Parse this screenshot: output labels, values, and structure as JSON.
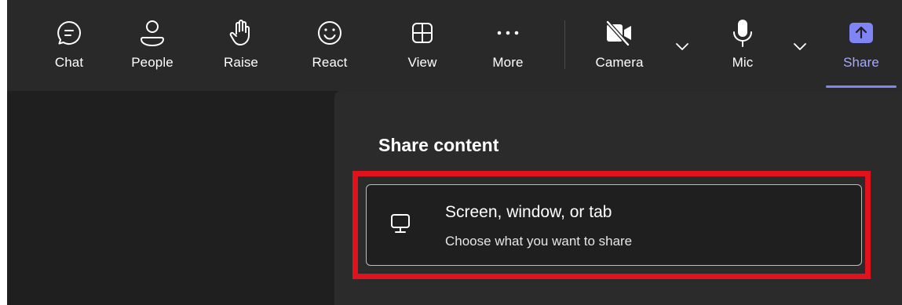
{
  "toolbar": {
    "chat_label": "Chat",
    "people_label": "People",
    "raise_label": "Raise",
    "react_label": "React",
    "view_label": "View",
    "more_label": "More",
    "camera_label": "Camera",
    "mic_label": "Mic",
    "share_label": "Share"
  },
  "icons": {
    "chat": "chat-icon",
    "people": "person-icon",
    "raise": "raise-hand-icon",
    "react": "smiley-icon",
    "view": "grid-icon",
    "more": "more-icon",
    "camera": "camera-off-icon",
    "mic": "mic-icon",
    "share": "share-tray-icon",
    "monitor": "monitor-icon"
  },
  "share_panel": {
    "title": "Share content",
    "option_title": "Screen, window, or tab",
    "option_subtitle": "Choose what you want to share"
  },
  "colors": {
    "accent": "#7f85f5",
    "highlight": "#e0131d",
    "toolbar_bg": "#292929",
    "panel_bg": "#2b2b2b"
  }
}
